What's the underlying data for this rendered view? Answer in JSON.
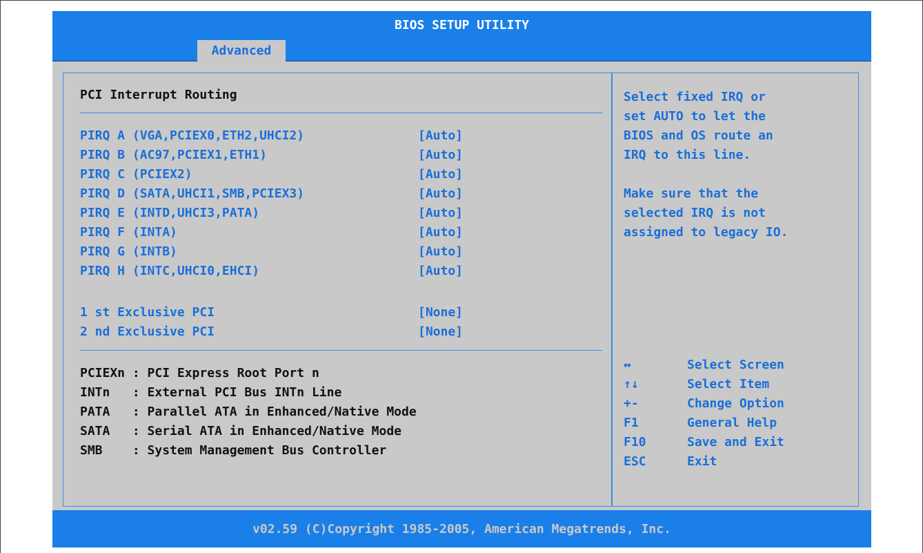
{
  "title": "BIOS SETUP UTILITY",
  "tabs": [
    {
      "label": "Advanced"
    }
  ],
  "section_title": "PCI Interrupt Routing",
  "settings": [
    {
      "label": "PIRQ A (VGA,PCIEX0,ETH2,UHCI2)",
      "value": "[Auto]"
    },
    {
      "label": "PIRQ B (AC97,PCIEX1,ETH1)",
      "value": "[Auto]"
    },
    {
      "label": "PIRQ C (PCIEX2)",
      "value": "[Auto]"
    },
    {
      "label": "PIRQ D (SATA,UHCI1,SMB,PCIEX3)",
      "value": "[Auto]"
    },
    {
      "label": "PIRQ E (INTD,UHCI3,PATA)",
      "value": "[Auto]"
    },
    {
      "label": "PIRQ F (INTA)",
      "value": "[Auto]"
    },
    {
      "label": "PIRQ G (INTB)",
      "value": "[Auto]"
    },
    {
      "label": "PIRQ H (INTC,UHCI0,EHCI)",
      "value": "[Auto]"
    },
    {
      "label": "1 st Exclusive PCI",
      "value": "[None]"
    },
    {
      "label": "2 nd Exclusive PCI",
      "value": "[None]"
    }
  ],
  "legend": [
    "PCIEXn : PCI Express Root Port n",
    "INTn   : External PCI Bus INTn Line",
    "PATA   : Parallel ATA in Enhanced/Native Mode",
    "SATA   : Serial ATA in Enhanced/Native Mode",
    "SMB    : System Management Bus Controller"
  ],
  "help": {
    "lines": [
      "Select fixed IRQ or",
      "set AUTO to let the",
      "BIOS and OS route an",
      "IRQ to this line.",
      "",
      "Make sure that the",
      "selected IRQ is not",
      "assigned to legacy IO."
    ],
    "keys": [
      {
        "key": "↔",
        "desc": "Select Screen",
        "icon": "left-right-arrow-icon"
      },
      {
        "key": "↑↓",
        "desc": "Select Item",
        "icon": "up-down-arrows-icon"
      },
      {
        "key": "+-",
        "desc": "Change Option"
      },
      {
        "key": "F1",
        "desc": "General Help"
      },
      {
        "key": "F10",
        "desc": "Save and Exit"
      },
      {
        "key": "ESC",
        "desc": "Exit"
      }
    ]
  },
  "footer": "v02.59 (C)Copyright 1985-2005, American Megatrends, Inc.",
  "colors": {
    "bar_blue": "#1a7fe8",
    "panel_gray": "#c9c9c9",
    "text_blue": "#1a6fd8"
  }
}
